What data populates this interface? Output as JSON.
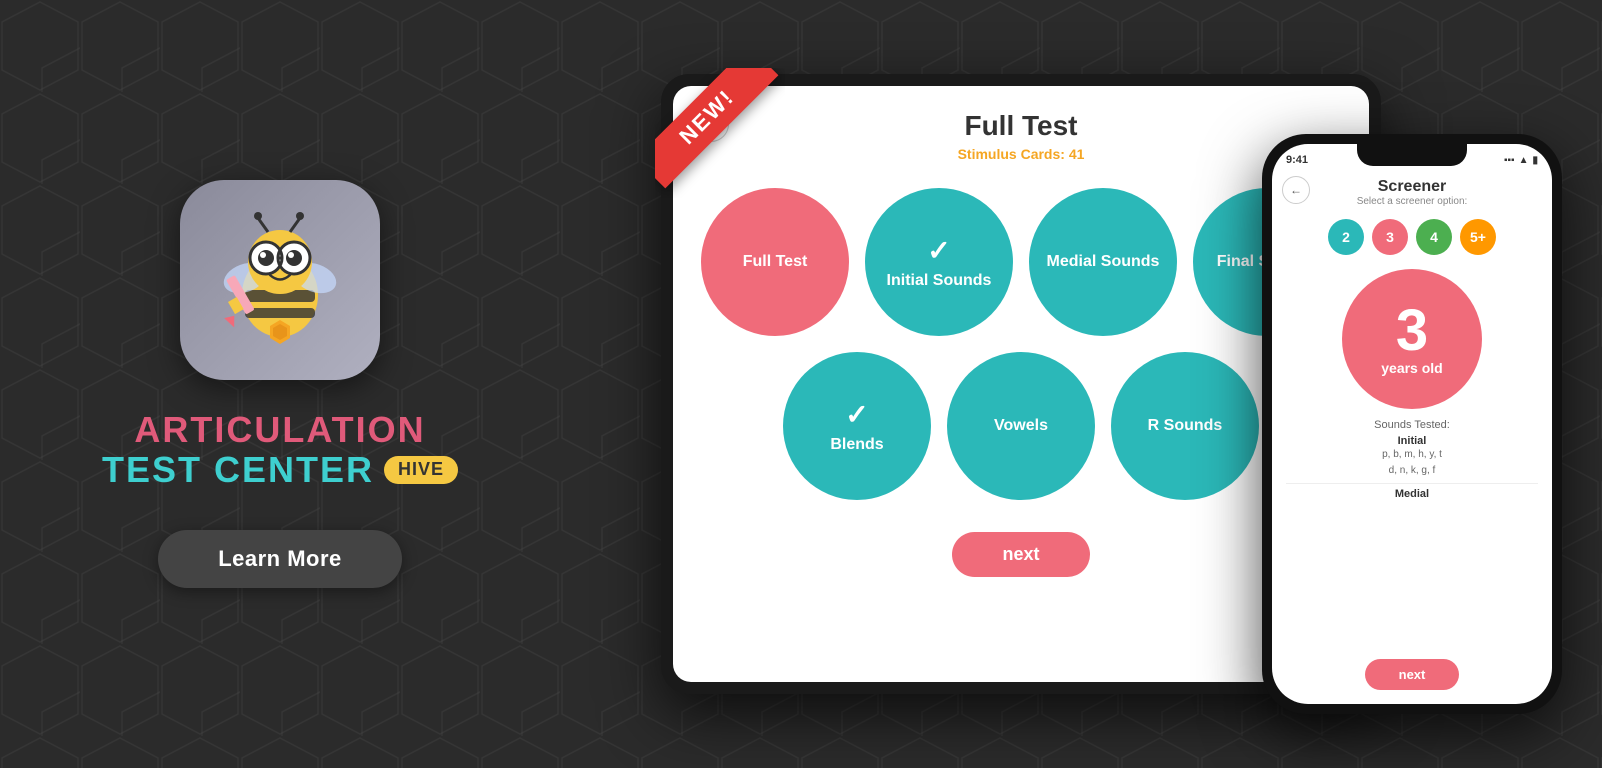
{
  "background": {
    "color": "#2b2b2b"
  },
  "left_panel": {
    "app_title_line1": "ARTICULATION",
    "app_title_line2": "TEST CENTER",
    "hive_badge": "hive",
    "learn_more_label": "Learn More"
  },
  "tablet": {
    "new_label": "NEW!",
    "back_icon": "←",
    "title": "Full Test",
    "stimulus_label": "Stimulus Cards:",
    "stimulus_count": "41",
    "circles": [
      {
        "label": "Full Test",
        "style": "coral",
        "checked": false
      },
      {
        "label": "Initial Sounds",
        "style": "teal",
        "checked": true
      },
      {
        "label": "Medial Sounds",
        "style": "teal",
        "checked": false
      },
      {
        "label": "Final Sounds",
        "style": "teal",
        "checked": false
      },
      {
        "label": "Blends",
        "style": "teal",
        "checked": true
      },
      {
        "label": "Vowels",
        "style": "teal",
        "checked": false
      },
      {
        "label": "R Sounds",
        "style": "teal",
        "checked": false
      }
    ],
    "next_label": "next"
  },
  "phone": {
    "status_time": "9:41",
    "status_signal": "●●●",
    "status_wifi": "▲",
    "status_battery": "▮",
    "back_icon": "←",
    "title": "Screener",
    "subtitle": "Select a screener option:",
    "age_buttons": [
      "2",
      "3",
      "4",
      "5+"
    ],
    "selected_age": "3",
    "age_text": "years old",
    "sounds_tested_label": "Sounds Tested:",
    "initial_label": "Initial",
    "initial_sounds": "p, b, m, h, y, t",
    "initial_sounds2": "d, n, k, g, f",
    "medial_label": "Medial",
    "next_label": "next"
  }
}
